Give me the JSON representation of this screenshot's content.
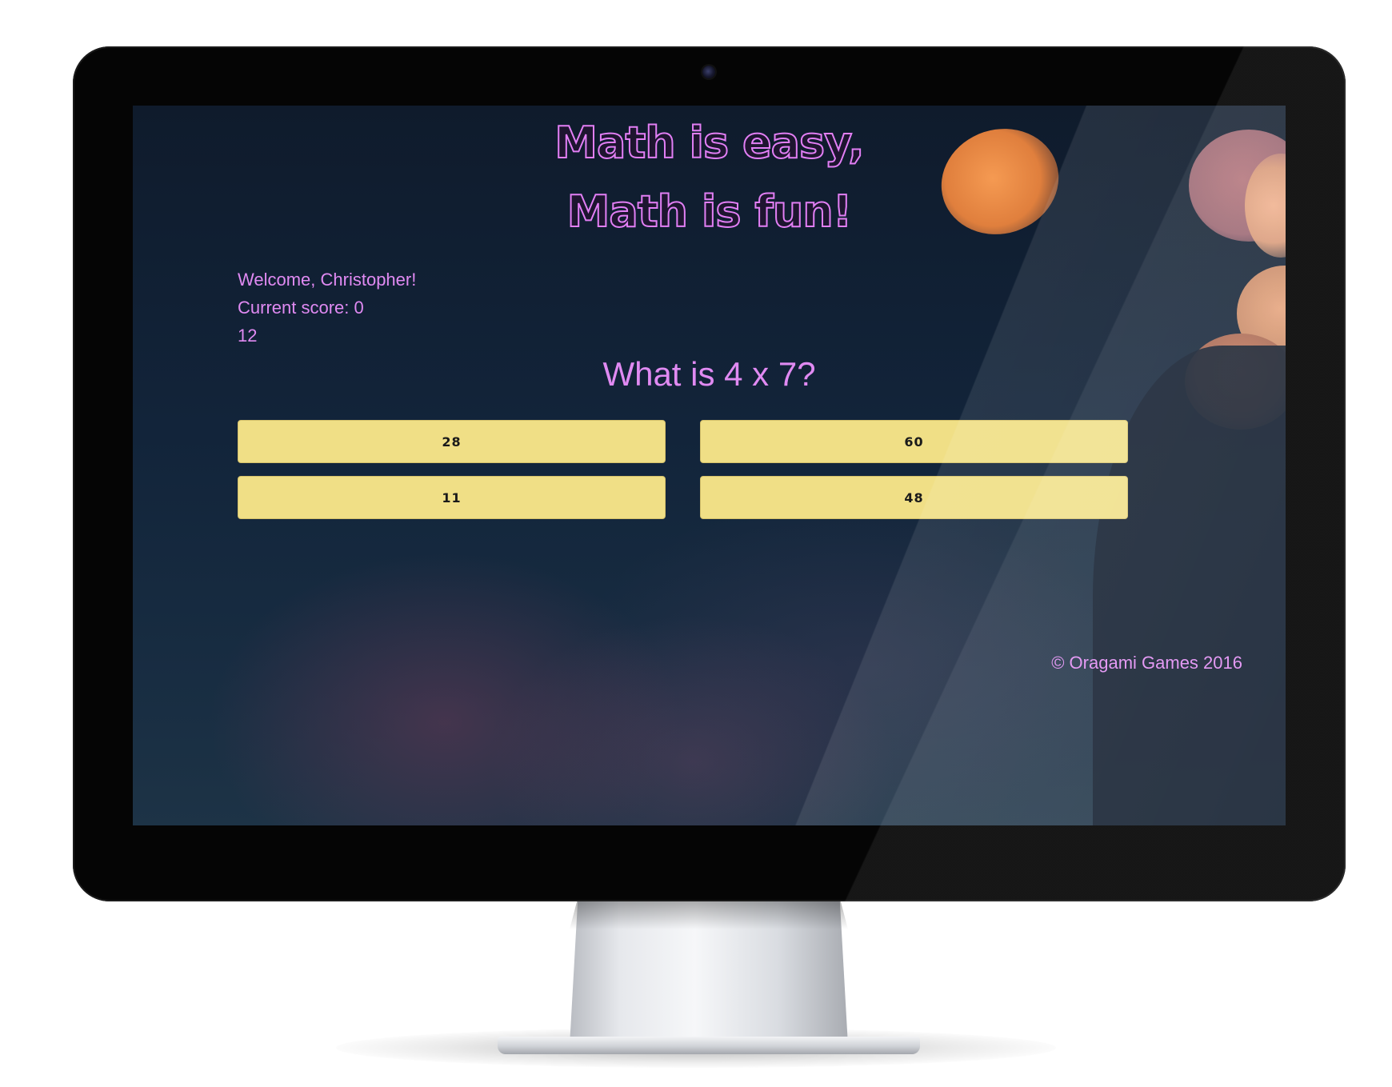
{
  "app": {
    "title_line1": "Math is easy,",
    "title_line2": "Math is fun!"
  },
  "player": {
    "welcome": "Welcome, Christopher!",
    "score": "Current score: 0",
    "timer": "12"
  },
  "question": {
    "text": "What is 4 x 7?"
  },
  "answers": [
    {
      "label": "28"
    },
    {
      "label": "60"
    },
    {
      "label": "11"
    },
    {
      "label": "48"
    }
  ],
  "footer": {
    "copyright": "© Oragami Games 2016"
  },
  "colors": {
    "accent_text": "#e08af2",
    "answer_button": "#f0df86",
    "bezel": "#050505"
  },
  "icons": {
    "camera": "webcam-icon"
  }
}
